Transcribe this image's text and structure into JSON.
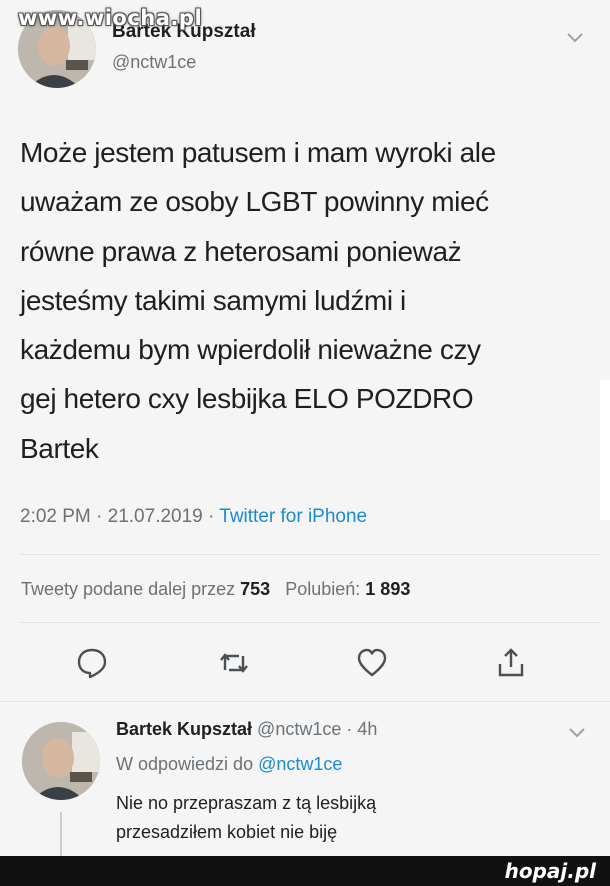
{
  "watermark_top": "www.wiocha.pl",
  "watermark_bottom": "hopaj.pl",
  "tweet": {
    "author_name": "Bartek Kupształ",
    "handle": "@nctw1ce",
    "text": "Może jestem patusem i mam wyroki ale\nuważam ze osoby LGBT powinny mieć\nrówne prawa z heterosami ponieważ\njesteśmy takimi samymi ludźmi i\nkażdemu bym wpierdolił nieważne czy\ngej hetero cxy lesbijka ELO POZDRO\nBartek",
    "time": "2:02 PM · 21.07.2019 · ",
    "source": "Twitter for iPhone",
    "retweets_label": "Tweety podane dalej przez",
    "retweets_count": "753",
    "likes_label": "Polubień:",
    "likes_count": "1 893"
  },
  "actions": {
    "reply_icon": "reply-icon",
    "retweet_icon": "retweet-icon",
    "like_icon": "like-icon",
    "share_icon": "share-icon"
  },
  "reply": {
    "author_name": "Bartek Kupształ",
    "handle_time": " @nctw1ce · 4h",
    "in_reply_prefix": "W odpowiedzi do ",
    "in_reply_handle": "@nctw1ce",
    "text": "Nie no przepraszam z tą lesbijką\nprzesadziłem kobiet nie biję"
  },
  "colors": {
    "background": "#f4f5f4",
    "text": "#1d1f22",
    "muted": "#6b7278",
    "link": "#1a8bd1"
  }
}
